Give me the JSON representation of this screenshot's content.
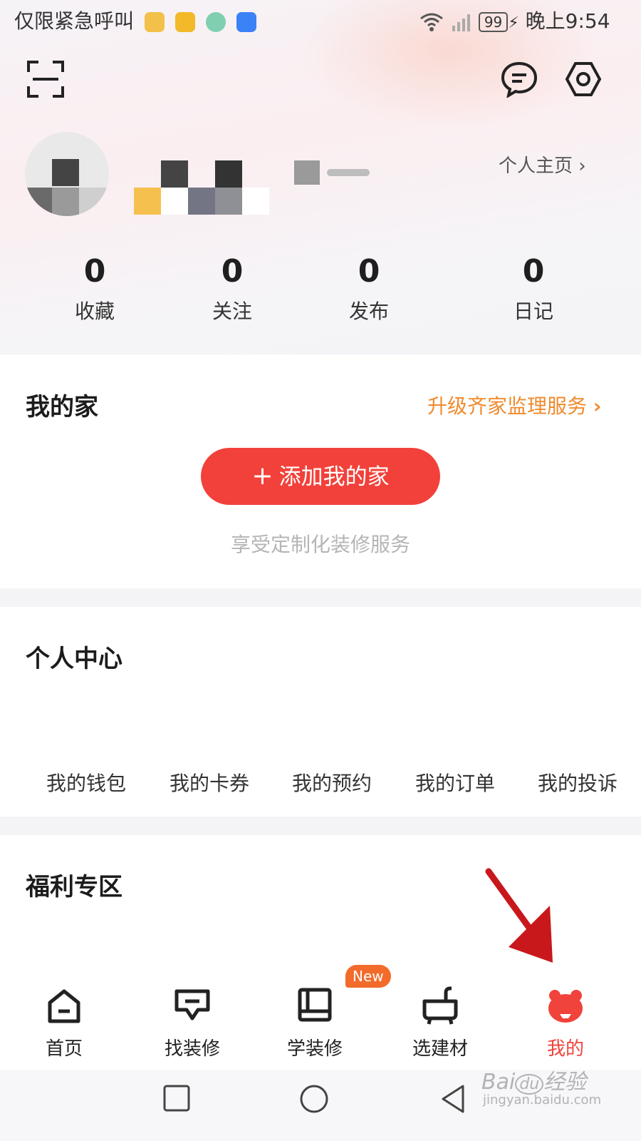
{
  "status_bar": {
    "carrier_text": "仅限紧急呼叫",
    "battery": "99",
    "time": "晚上9:54"
  },
  "profile": {
    "homepage_link": "个人主页"
  },
  "stats": [
    {
      "value": "0",
      "label": "收藏"
    },
    {
      "value": "0",
      "label": "关注"
    },
    {
      "value": "0",
      "label": "发布"
    },
    {
      "value": "0",
      "label": "日记"
    }
  ],
  "my_home": {
    "title": "我的家",
    "upgrade_link": "升级齐家监理服务",
    "add_button": "添加我的家",
    "subtitle": "享受定制化装修服务"
  },
  "personal_center": {
    "title": "个人中心",
    "items": [
      "我的钱包",
      "我的卡券",
      "我的预约",
      "我的订单",
      "我的投诉"
    ]
  },
  "welfare": {
    "title": "福利专区"
  },
  "tab_bar": {
    "items": [
      {
        "label": "首页",
        "icon": "home-icon"
      },
      {
        "label": "找装修",
        "icon": "find-renovation-icon"
      },
      {
        "label": "学装修",
        "icon": "learn-renovation-icon",
        "badge": "New"
      },
      {
        "label": "选建材",
        "icon": "materials-icon"
      },
      {
        "label": "我的",
        "icon": "profile-bear-icon",
        "active": true
      }
    ]
  },
  "watermark": {
    "brand": "Bai",
    "paw": "du",
    "suffix": "经验",
    "url": "jingyan.baidu.com"
  },
  "colors": {
    "accent_red": "#f2413a",
    "orange": "#f08a2d",
    "active_tab": "#f0433c",
    "badge_orange": "#f26b2b",
    "arrow_red": "#c8181c"
  }
}
